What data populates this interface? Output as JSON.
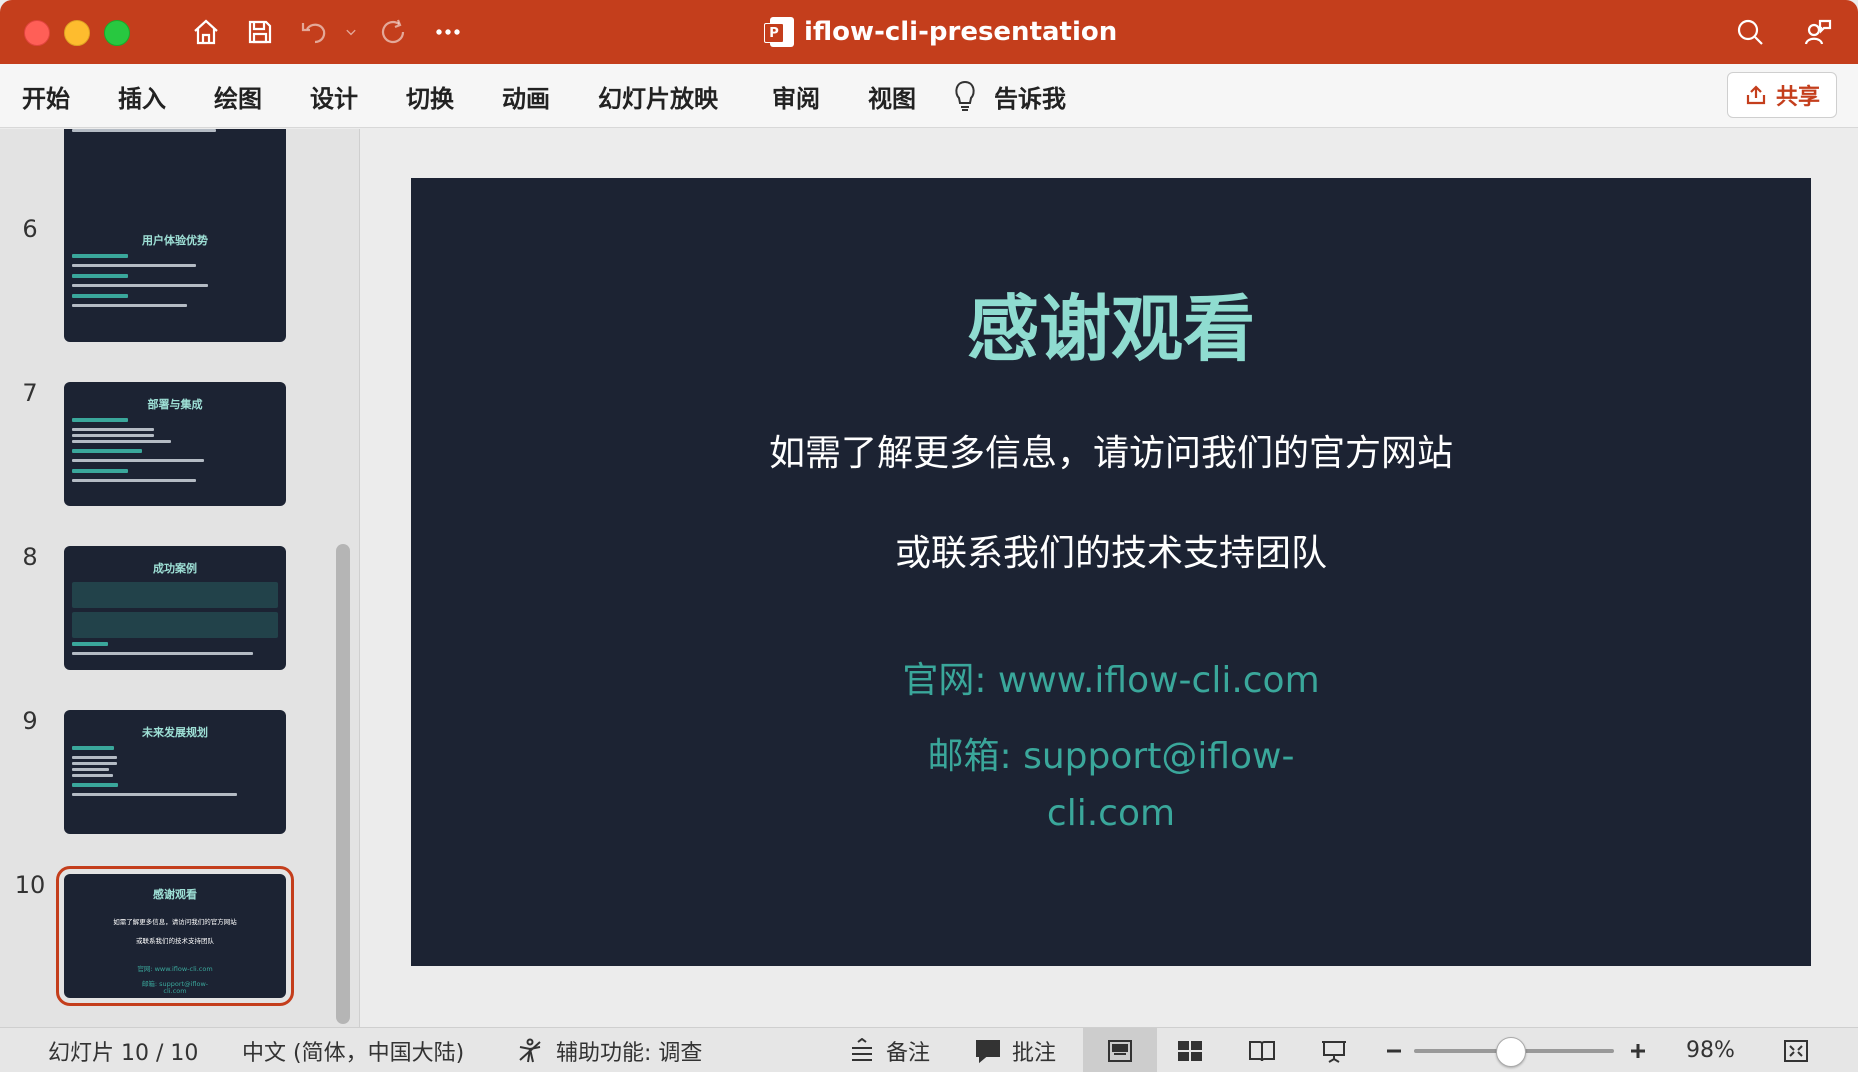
{
  "window": {
    "title": "iflow-cli-presentation"
  },
  "ribbon": {
    "tabs": [
      "开始",
      "插入",
      "绘图",
      "设计",
      "切换",
      "动画",
      "幻灯片放映",
      "审阅",
      "视图"
    ],
    "tell_me": "告诉我",
    "share": "共享"
  },
  "sidebar": {
    "thumbnails": [
      {
        "number": "6",
        "title": "用户体验优势"
      },
      {
        "number": "7",
        "title": "部署与集成"
      },
      {
        "number": "8",
        "title": "成功案例"
      },
      {
        "number": "9",
        "title": "未来发展规划"
      },
      {
        "number": "10",
        "title": "感谢观看",
        "line1": "如需了解更多信息，请访问我们的官方网站",
        "line2": "或联系我们的技术支持团队",
        "line3": "官网: www.iflow-cli.com",
        "line4": "邮箱: support@iflow-",
        "line5": "cli.com"
      }
    ]
  },
  "slide": {
    "title": "感谢观看",
    "line1": "如需了解更多信息，请访问我们的官方网站",
    "line2": "或联系我们的技术支持团队",
    "website": "官网: www.iflow-cli.com",
    "email_part1": "邮箱: support@iflow-",
    "email_part2": "cli.com"
  },
  "statusbar": {
    "slide_counter": "幻灯片 10 / 10",
    "language": "中文 (简体，中国大陆)",
    "accessibility": "辅助功能: 调查",
    "notes": "备注",
    "comments": "批注",
    "zoom": "98%"
  },
  "colors": {
    "accent": "#c43e1c",
    "slide_bg": "#1c2333",
    "slide_title": "#8fdcd0",
    "slide_link": "#3aa79b"
  }
}
